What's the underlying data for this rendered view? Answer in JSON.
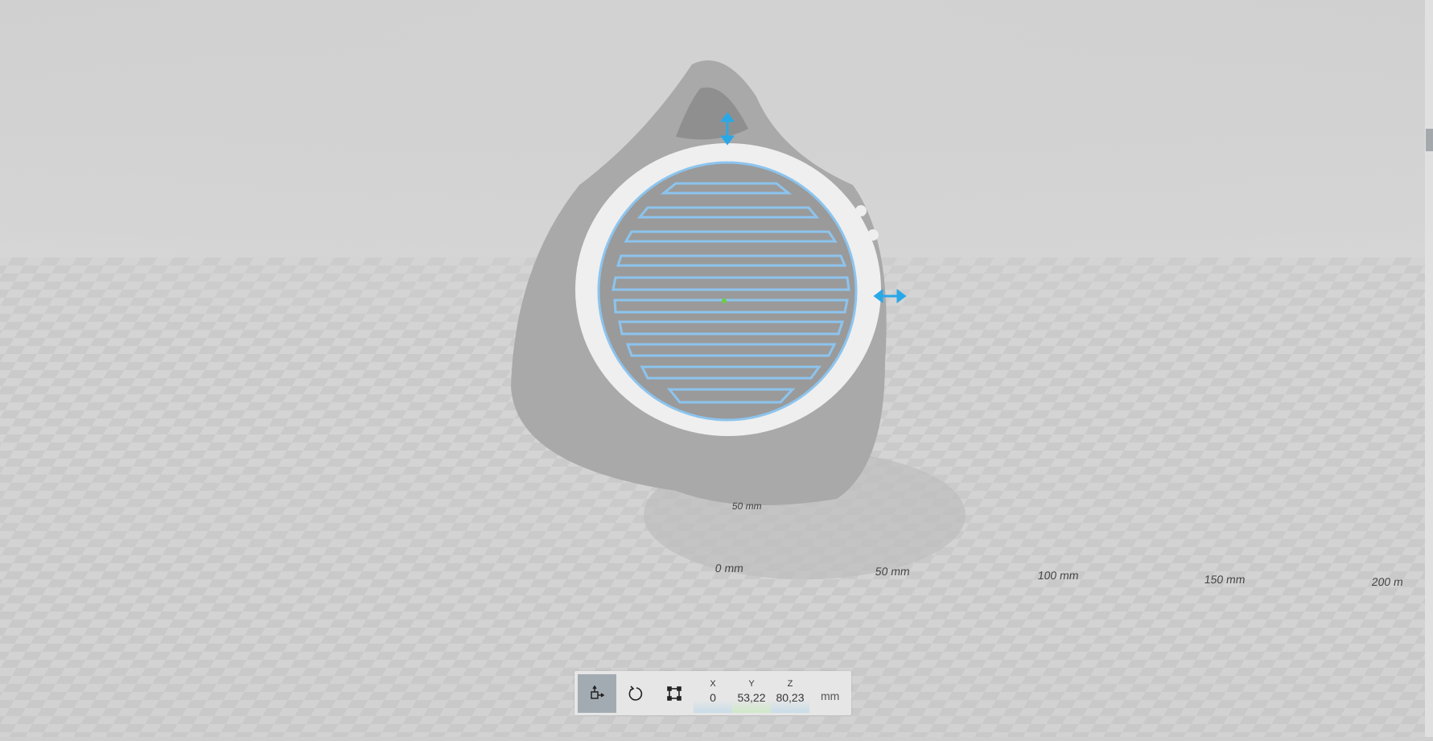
{
  "viewport": {
    "ruler_labels": [
      "0 mm",
      "50 mm",
      "100 mm",
      "150 mm",
      "200 m"
    ],
    "ruler_depth_label": "50 mm"
  },
  "toolbar": {
    "tools": [
      {
        "name": "move",
        "icon": "move-icon",
        "active": true
      },
      {
        "name": "rotate",
        "icon": "rotate-icon",
        "active": false
      },
      {
        "name": "scale",
        "icon": "scale-icon",
        "active": false
      }
    ],
    "coords": [
      {
        "label": "X",
        "value": "0",
        "color": "#c9dde8"
      },
      {
        "label": "Y",
        "value": "53,22",
        "color": "#cfe8c8"
      },
      {
        "label": "Z",
        "value": "80,23",
        "color": "#c9dde8"
      }
    ],
    "unit": "mm"
  },
  "colors": {
    "accent": "#29a8e8",
    "selection": "#8cc4ee"
  }
}
